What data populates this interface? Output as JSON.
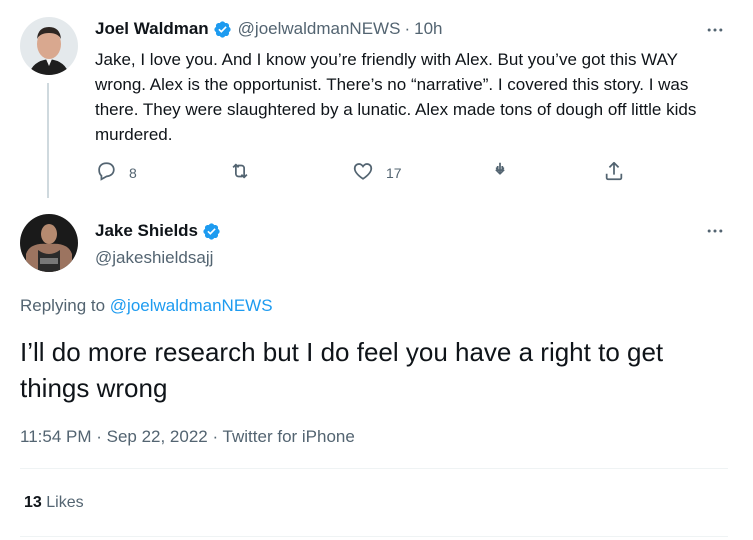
{
  "parent_tweet": {
    "name": "Joel Waldman",
    "handle": "@joelwaldmanNEWS",
    "time": "10h",
    "text": "Jake, I love you. And I know you’re friendly with Alex. But you’ve got this WAY wrong. Alex is the opportunist. There’s no “narrative”. I covered this story. I was there. They were slaughtered by a lunatic. Alex made tons of dough off little kids murdered.",
    "reply_count": "8",
    "retweet_count": "",
    "like_count": "17",
    "verified": true
  },
  "main_tweet": {
    "name": "Jake Shields",
    "handle": "@jakeshieldsajj",
    "verified": true,
    "replying_prefix": "Replying to",
    "replying_to": "@joelwaldmanNEWS",
    "text": "I’ll do more research but I do feel you have a right to get things wrong",
    "timestamp": "11:54 PM · Sep 22, 2022 · Twitter for iPhone",
    "likes_count": "13",
    "likes_label": "Likes"
  },
  "icons": {
    "reply": "reply-icon",
    "retweet": "retweet-icon",
    "like": "heart-icon",
    "bookmark": "bookmark-icon",
    "share": "share-icon",
    "more": "more-icon",
    "verified": "verified-badge-icon"
  },
  "colors": {
    "accent": "#1d9bf0",
    "text": "#0f1419",
    "secondary": "#536471",
    "thread_line": "#cfd9de",
    "divider": "#eff3f4"
  }
}
